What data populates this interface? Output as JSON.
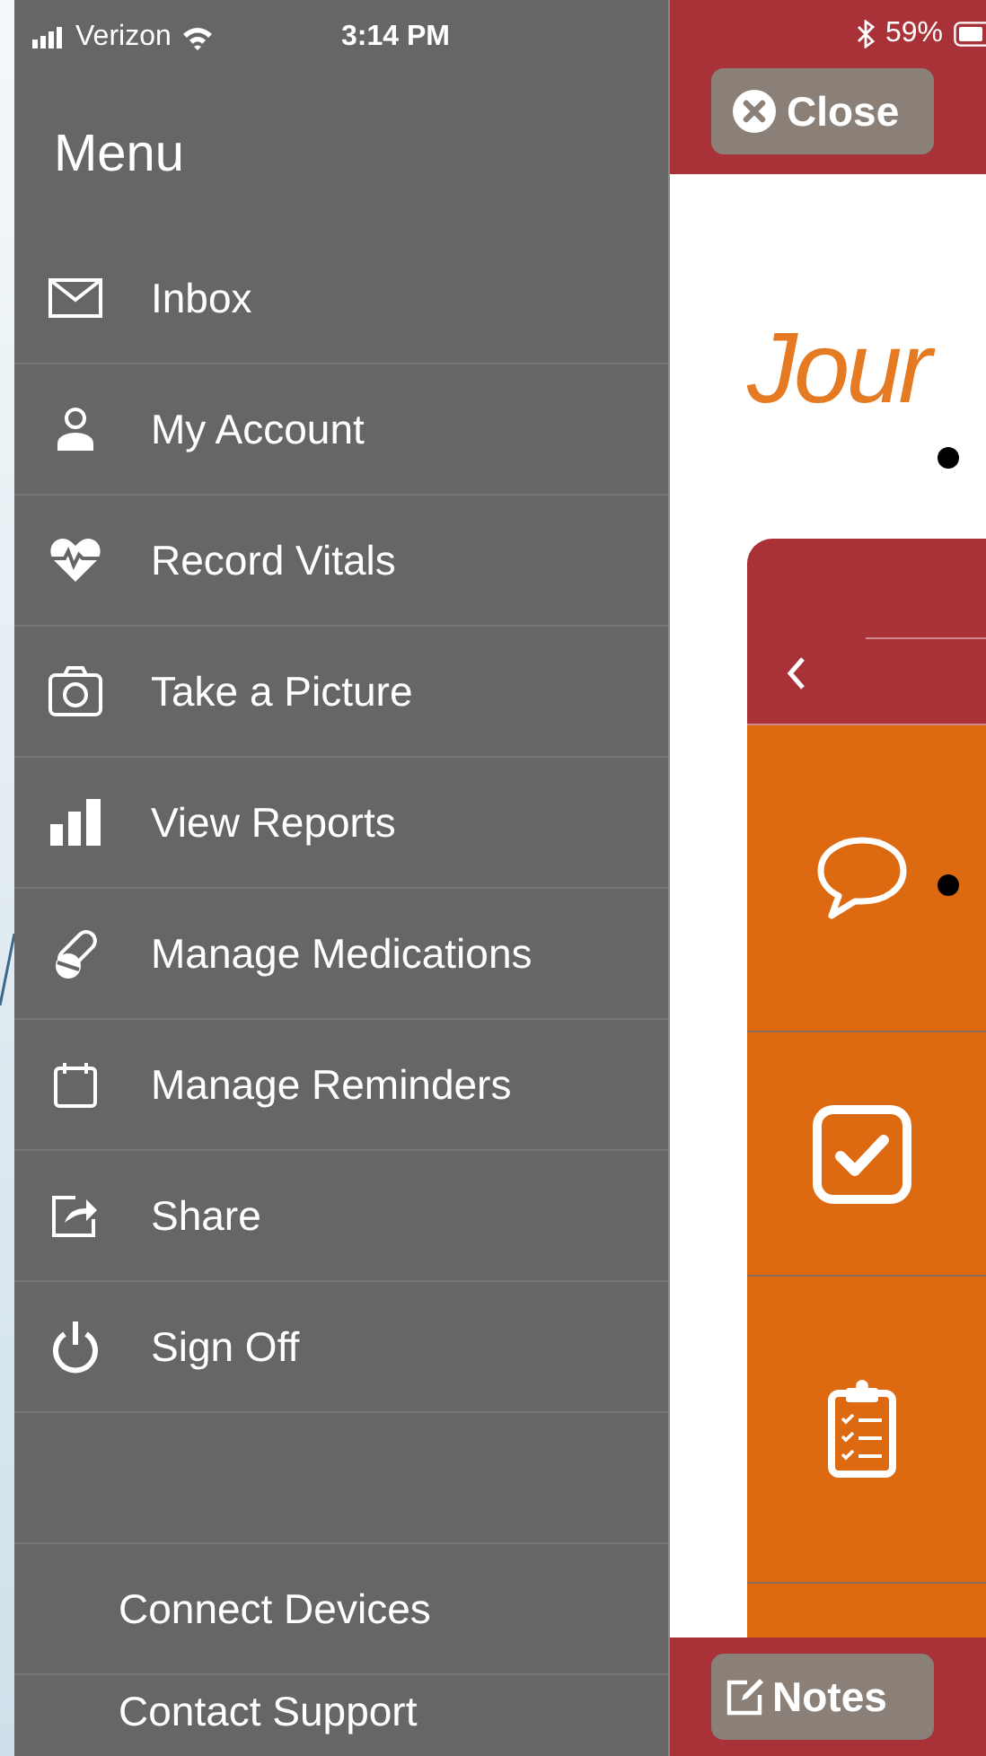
{
  "status_bar": {
    "carrier": "Verizon",
    "time": "3:14 PM",
    "battery": "59%"
  },
  "menu": {
    "title": "Menu",
    "items": [
      {
        "label": "Inbox"
      },
      {
        "label": "My Account"
      },
      {
        "label": "Record Vitals"
      },
      {
        "label": "Take a Picture"
      },
      {
        "label": "View Reports"
      },
      {
        "label": "Manage Medications"
      },
      {
        "label": "Manage Reminders"
      },
      {
        "label": "Share"
      },
      {
        "label": "Sign Off"
      }
    ],
    "footer_items": [
      {
        "label": "Connect Devices"
      },
      {
        "label": "Contact Support"
      }
    ]
  },
  "close_button": {
    "label": "Close"
  },
  "page": {
    "logo_text": "Jour"
  },
  "notes_button": {
    "label": "Notes"
  }
}
